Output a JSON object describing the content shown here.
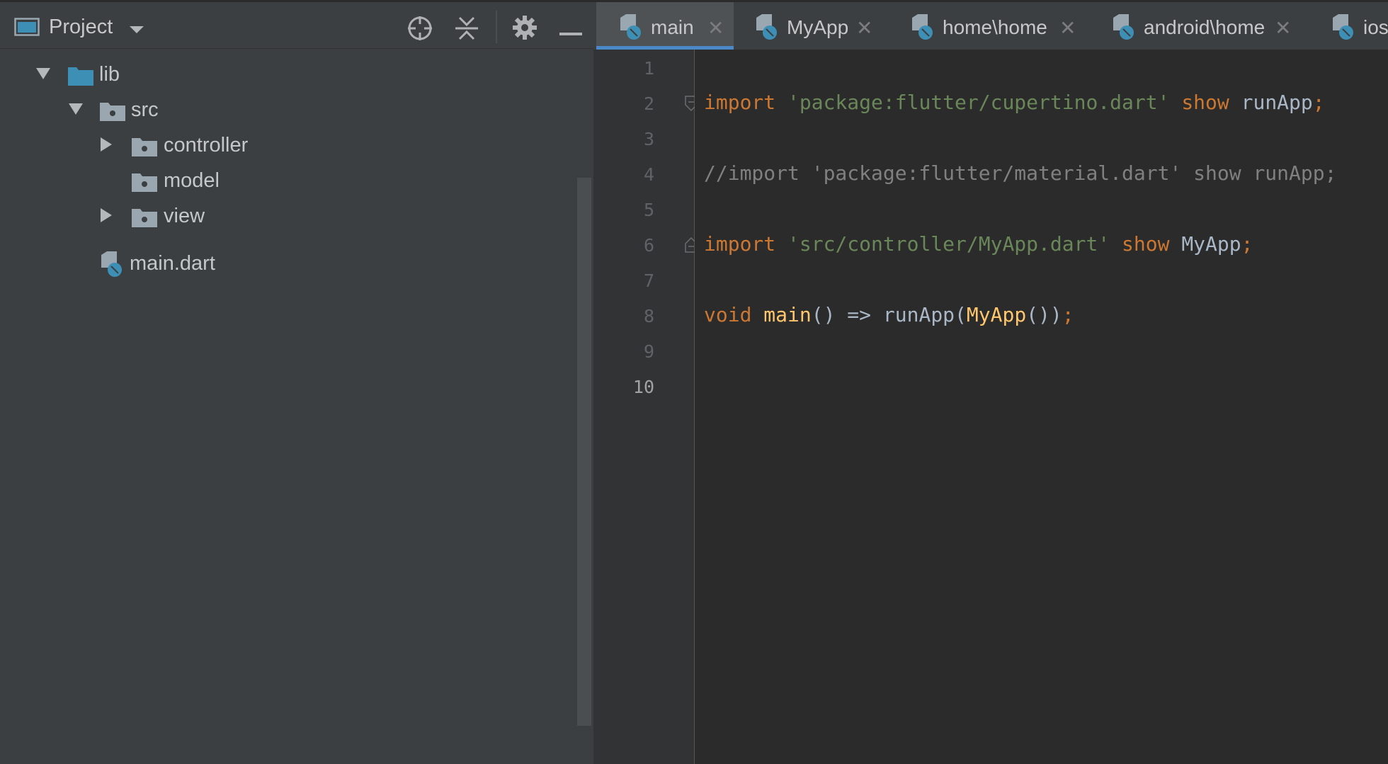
{
  "project_panel": {
    "title": "Project",
    "icons": [
      "window-icon",
      "dropdown-icon",
      "locate-icon",
      "collapse-all-icon",
      "gear-icon",
      "minimize-icon"
    ],
    "tree": [
      {
        "label": "lib",
        "expanded": true,
        "type": "folder"
      },
      {
        "label": "src",
        "expanded": true,
        "type": "folder"
      },
      {
        "label": "controller",
        "expanded": false,
        "type": "folder"
      },
      {
        "label": "model",
        "expanded": null,
        "type": "folder"
      },
      {
        "label": "view",
        "expanded": false,
        "type": "folder"
      },
      {
        "label": "main.dart",
        "type": "dart-file"
      }
    ]
  },
  "editor": {
    "tabs": [
      {
        "label": "main",
        "active": true
      },
      {
        "label": "MyApp",
        "active": false
      },
      {
        "label": "home\\home",
        "active": false
      },
      {
        "label": "android\\home",
        "active": false
      },
      {
        "label": "ios",
        "active": false
      }
    ],
    "line_numbers": [
      "1",
      "2",
      "3",
      "4",
      "5",
      "6",
      "7",
      "8",
      "9",
      "10"
    ],
    "current_line": "10",
    "code": {
      "line2": {
        "kw": "import",
        "str": "'package:flutter/cupertino.dart'",
        "show": "show",
        "id": "runApp",
        "semi": ";"
      },
      "line4": {
        "comment": "//import 'package:flutter/material.dart' show runApp;"
      },
      "line6": {
        "kw": "import",
        "str": "'src/controller/MyApp.dart'",
        "show": "show",
        "id": "MyApp",
        "semi": ";"
      },
      "line8": {
        "kw": "void",
        "fn": "main",
        "p1": "() => ",
        "call": "runApp",
        "p2": "(",
        "cls": "MyApp",
        "p3": "())",
        "semi": ";"
      }
    }
  },
  "colors": {
    "keyword": "#cc7832",
    "string": "#6a8759",
    "identifier": "#a9b7c6",
    "function": "#ffc66d",
    "comment": "#808080",
    "folder": "#3d8fb5",
    "tab_underline": "#4a88c7"
  }
}
